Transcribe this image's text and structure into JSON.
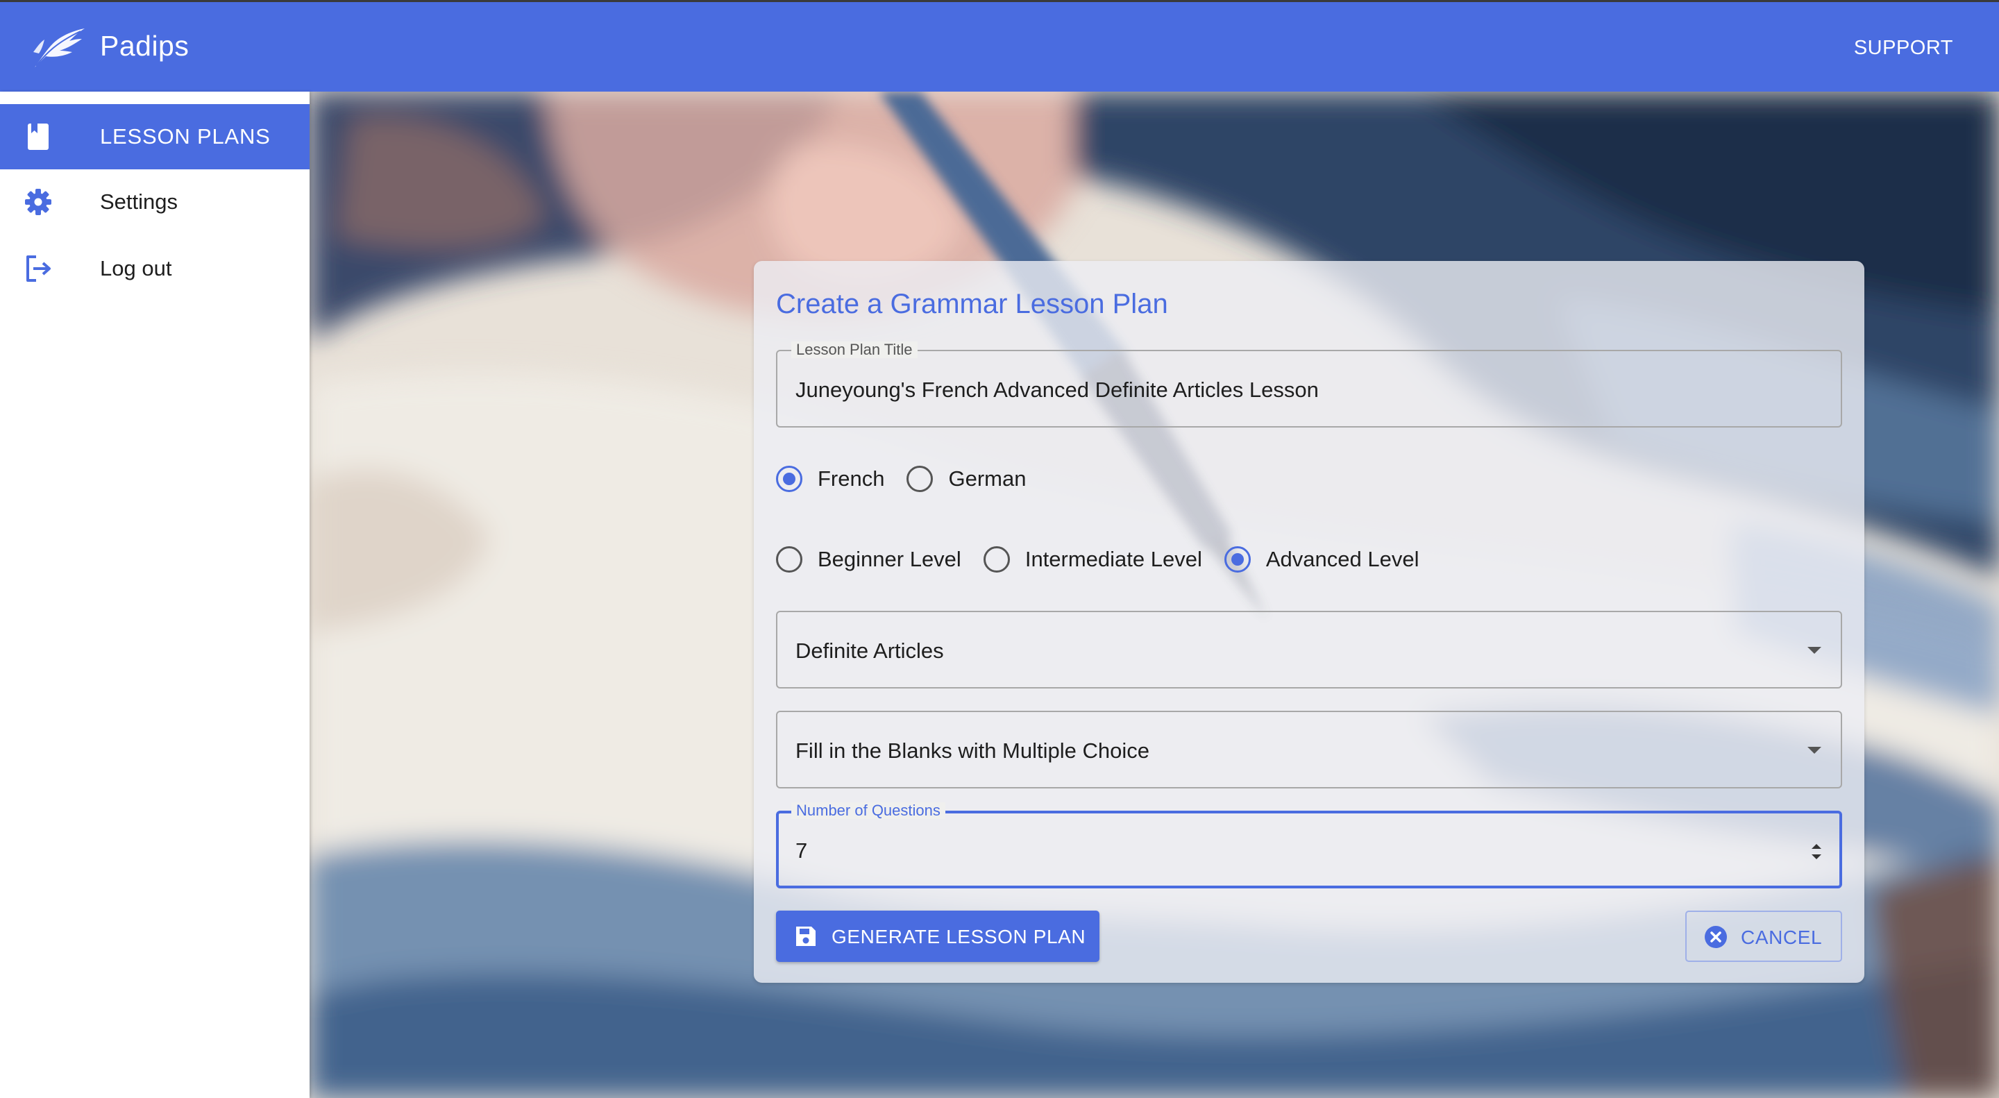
{
  "app": {
    "name": "Padips",
    "logo_icon": "quill-feather-icon",
    "support_label": "SUPPORT",
    "accent_color": "#4a6ce0"
  },
  "sidebar": {
    "items": [
      {
        "label": "LESSON PLANS",
        "icon": "book-icon",
        "active": true
      },
      {
        "label": "Settings",
        "icon": "gear-icon",
        "active": false
      },
      {
        "label": "Log out",
        "icon": "logout-icon",
        "active": false
      }
    ]
  },
  "form": {
    "title": "Create a Grammar Lesson Plan",
    "lesson_title_field": {
      "label": "Lesson Plan Title",
      "value": "Juneyoung's French Advanced Definite Articles Lesson"
    },
    "languages": [
      {
        "label": "French",
        "checked": true
      },
      {
        "label": "German",
        "checked": false
      }
    ],
    "levels": [
      {
        "label": "Beginner Level",
        "checked": false
      },
      {
        "label": "Intermediate Level",
        "checked": false
      },
      {
        "label": "Advanced Level",
        "checked": true
      }
    ],
    "topic_select": {
      "value": "Definite Articles"
    },
    "exercise_select": {
      "value": "Fill in the Blanks with Multiple Choice"
    },
    "questions_field": {
      "label": "Number of Questions",
      "value": "7"
    },
    "generate_label": "GENERATE LESSON PLAN",
    "generate_icon": "save-icon",
    "cancel_label": "CANCEL",
    "cancel_icon": "close-circle-icon"
  }
}
